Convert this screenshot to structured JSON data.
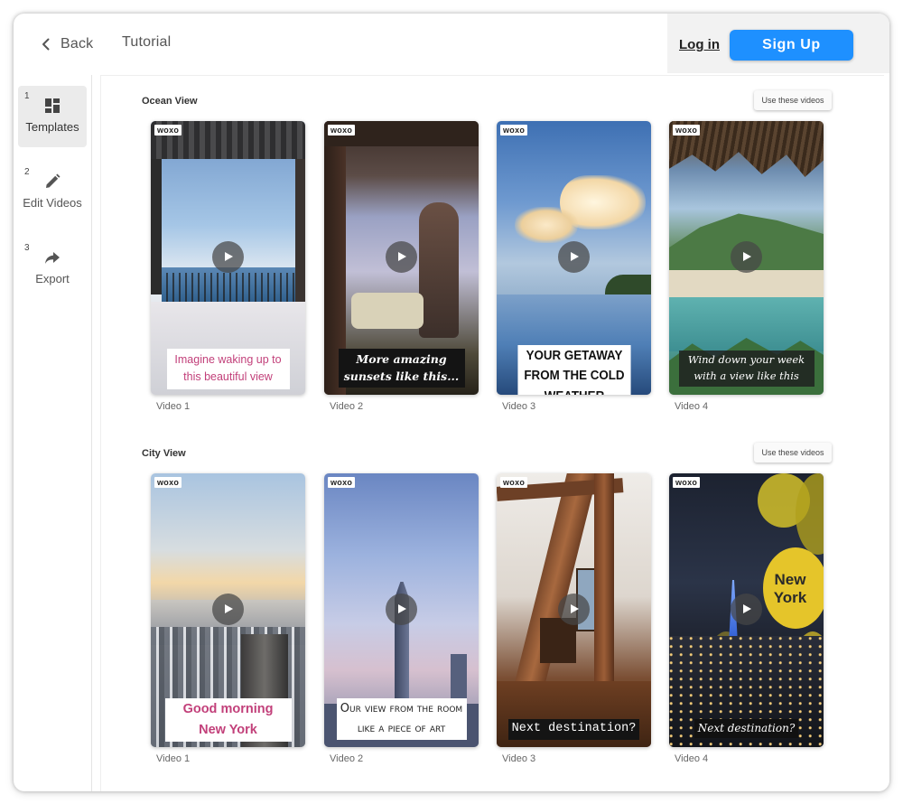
{
  "header": {
    "back_label": "Back",
    "tutorial_label": "Tutorial",
    "login_label": "Log in",
    "signup_label": "Sign Up"
  },
  "sidebar": {
    "steps": [
      {
        "number": "1",
        "label": "Templates",
        "icon": "dashboard-icon",
        "active": true
      },
      {
        "number": "2",
        "label": "Edit Videos",
        "icon": "pencil-icon",
        "active": false
      },
      {
        "number": "3",
        "label": "Export",
        "icon": "share-arrow-icon",
        "active": false
      }
    ]
  },
  "sections": [
    {
      "title": "Ocean View",
      "use_button_label": "Use these videos",
      "videos": [
        {
          "label": "Video 1",
          "badge": "woxo",
          "caption": "Imagine waking up to this beautiful view"
        },
        {
          "label": "Video 2",
          "badge": "woxo",
          "caption": "More amazing sunsets like this..."
        },
        {
          "label": "Video 3",
          "badge": "woxo",
          "caption": "YOUR GETAWAY FROM THE COLD WEATHER"
        },
        {
          "label": "Video 4",
          "badge": "woxo",
          "caption": "Wind down your week with a view like this"
        }
      ]
    },
    {
      "title": "City View",
      "use_button_label": "Use these videos",
      "videos": [
        {
          "label": "Video 1",
          "badge": "woxo",
          "caption": "Good morning New York"
        },
        {
          "label": "Video 2",
          "badge": "woxo",
          "caption": "Our view from the room like a piece of art"
        },
        {
          "label": "Video 3",
          "badge": "woxo",
          "caption": "Next destination?"
        },
        {
          "label": "Video 4",
          "badge": "woxo",
          "caption": "Next destination?",
          "overlay_text": "New York"
        }
      ]
    }
  ],
  "colors": {
    "accent": "#1e90ff",
    "caption_pink": "#c2407a"
  }
}
